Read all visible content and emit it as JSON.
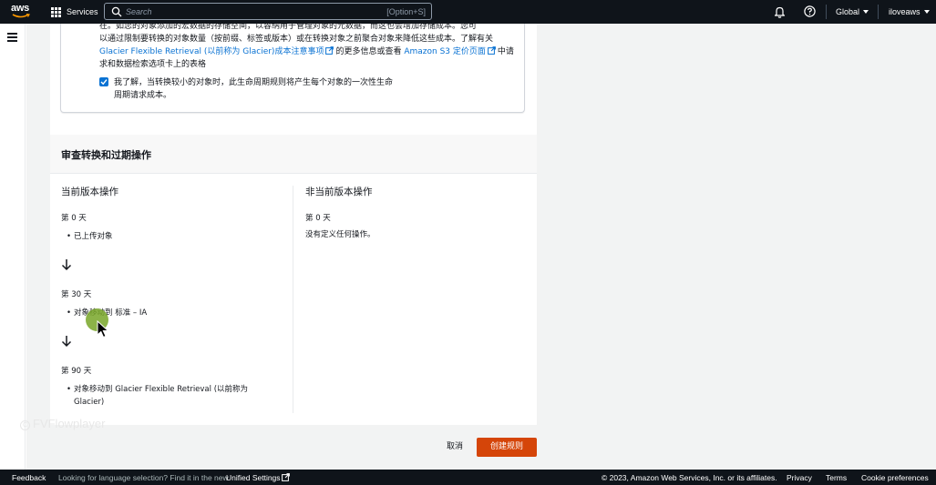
{
  "topnav": {
    "logo_text": "aws",
    "services_label": "Services",
    "search_placeholder": "Search",
    "search_shortcut": "[Option+S]",
    "region_label": "Global",
    "account_label": "iloveaws"
  },
  "notice": {
    "line1_partial": "在。如您的对象添加的宏数据的存储空间，以容纳用于管理对象的元数据，而这也会增加存储成本。您可",
    "line2": "以通过限制要转换的对象数量（按前缀、标签或版本）或在转换对象之前聚合对象来降低这些成本。了解有关",
    "line3_link1": "Glacier Flexible Retrieval (以前称为 Glacier)成本注意事项",
    "line3_mid": "的更多信息或查看",
    "line3_link2": "Amazon S3 定价页面",
    "line3_end": "中请",
    "line4": "求和数据检索选项卡上的表格",
    "ack_line1": "我了解，当转换较小的对象时，此生命周期规则将产生每个对象的一次性生命",
    "ack_line2": "周期请求成本。",
    "ack_checked": true
  },
  "review": {
    "section_title": "审查转换和过期操作",
    "current": {
      "title": "当前版本操作",
      "steps": [
        {
          "day": "第 0 天",
          "action": "已上传对象"
        },
        {
          "day": "第 30 天",
          "action": "对象移动到 标准 – IA"
        },
        {
          "day": "第 90 天",
          "action_line1": "对象移动到 Glacier Flexible Retrieval (以前称为",
          "action_line2": "Glacier)"
        }
      ]
    },
    "noncurrent": {
      "title": "非当前版本操作",
      "day": "第 0 天",
      "note": "没有定义任何操作。"
    }
  },
  "actions": {
    "cancel_label": "取消",
    "create_label": "创建规则"
  },
  "watermark": {
    "text": "FVFlowplayer",
    "symbol": "C"
  },
  "footer": {
    "feedback": "Feedback",
    "language_note": "Looking for language selection? Find it in the new",
    "unified_settings": "Unified Settings",
    "copyright": "© 2023, Amazon Web Services, Inc. or its affiliates.",
    "privacy": "Privacy",
    "terms": "Terms",
    "cookies": "Cookie preferences"
  },
  "colors": {
    "nav_bg": "#0f141a",
    "link": "#0972d3",
    "primary_button": "#d54509",
    "page_bg": "#f2f3f3"
  }
}
